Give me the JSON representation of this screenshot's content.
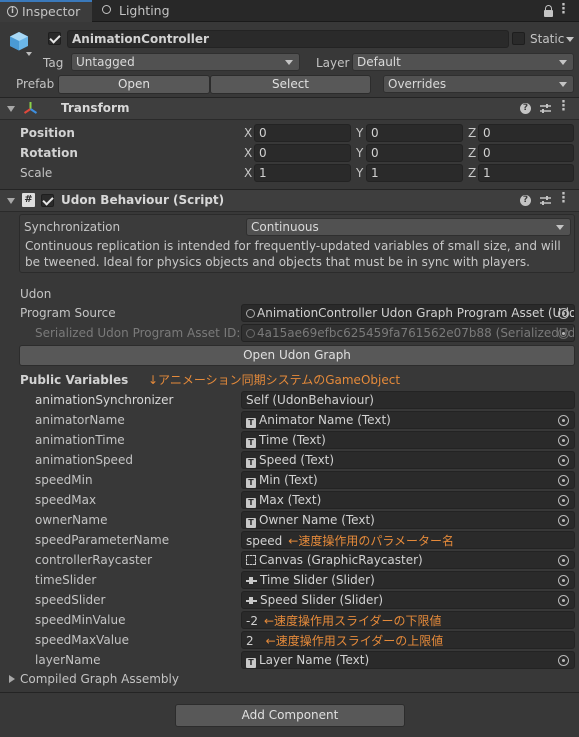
{
  "tabs": {
    "inspector": "Inspector",
    "lighting": "Lighting"
  },
  "object": {
    "name": "AnimationController",
    "static_label": "Static",
    "tag_label": "Tag",
    "tag_value": "Untagged",
    "layer_label": "Layer",
    "layer_value": "Default",
    "prefab_label": "Prefab",
    "open": "Open",
    "select": "Select",
    "overrides": "Overrides"
  },
  "transform": {
    "title": "Transform",
    "position": {
      "label": "Position",
      "x": "0",
      "y": "0",
      "z": "0"
    },
    "rotation": {
      "label": "Rotation",
      "x": "0",
      "y": "0",
      "z": "0"
    },
    "scale": {
      "label": "Scale",
      "x": "1",
      "y": "1",
      "z": "1"
    },
    "axes": {
      "x": "X",
      "y": "Y",
      "z": "Z"
    }
  },
  "udon": {
    "title": "Udon Behaviour (Script)",
    "sync_label": "Synchronization",
    "sync_value": "Continuous",
    "help": "Continuous replication is intended for frequently-updated variables of small size, and will be tweened. Ideal for physics objects and objects that must be in sync with players.",
    "section": "Udon",
    "program_source_label": "Program Source",
    "program_source_value": "AnimationController Udon Graph Program Asset (Udon",
    "serialized_label": "Serialized Udon Program Asset ID:",
    "serialized_value": "4a15ae69efbc625459fa761562e07b88 (SerializedUd",
    "open_graph": "Open Udon Graph",
    "public_vars": "Public Variables",
    "public_note": "↓アニメーション同期システムのGameObject",
    "vars": [
      {
        "name": "animationSynchronizer",
        "value": "Self (UdonBehaviour)"
      },
      {
        "name": "animatorName",
        "value": "Animator Name (Text)"
      },
      {
        "name": "animationTime",
        "value": "Time (Text)"
      },
      {
        "name": "animationSpeed",
        "value": "Speed (Text)"
      },
      {
        "name": "speedMin",
        "value": "Min (Text)"
      },
      {
        "name": "speedMax",
        "value": "Max (Text)"
      },
      {
        "name": "ownerName",
        "value": "Owner Name (Text)"
      },
      {
        "name": "speedParameterName",
        "value": "speed",
        "note": "←速度操作用のパラメーター名"
      },
      {
        "name": "controllerRaycaster",
        "value": "Canvas (GraphicRaycaster)"
      },
      {
        "name": "timeSlider",
        "value": "Time Slider (Slider)"
      },
      {
        "name": "speedSlider",
        "value": "Speed Slider (Slider)"
      },
      {
        "name": "speedMinValue",
        "value": "-2",
        "note": "←速度操作用スライダーの下限値"
      },
      {
        "name": "speedMaxValue",
        "value": "2",
        "note": "←速度操作用スライダーの上限値"
      },
      {
        "name": "layerName",
        "value": "Layer Name (Text)"
      }
    ],
    "compiled": "Compiled Graph Assembly"
  },
  "add_component": "Add Component"
}
